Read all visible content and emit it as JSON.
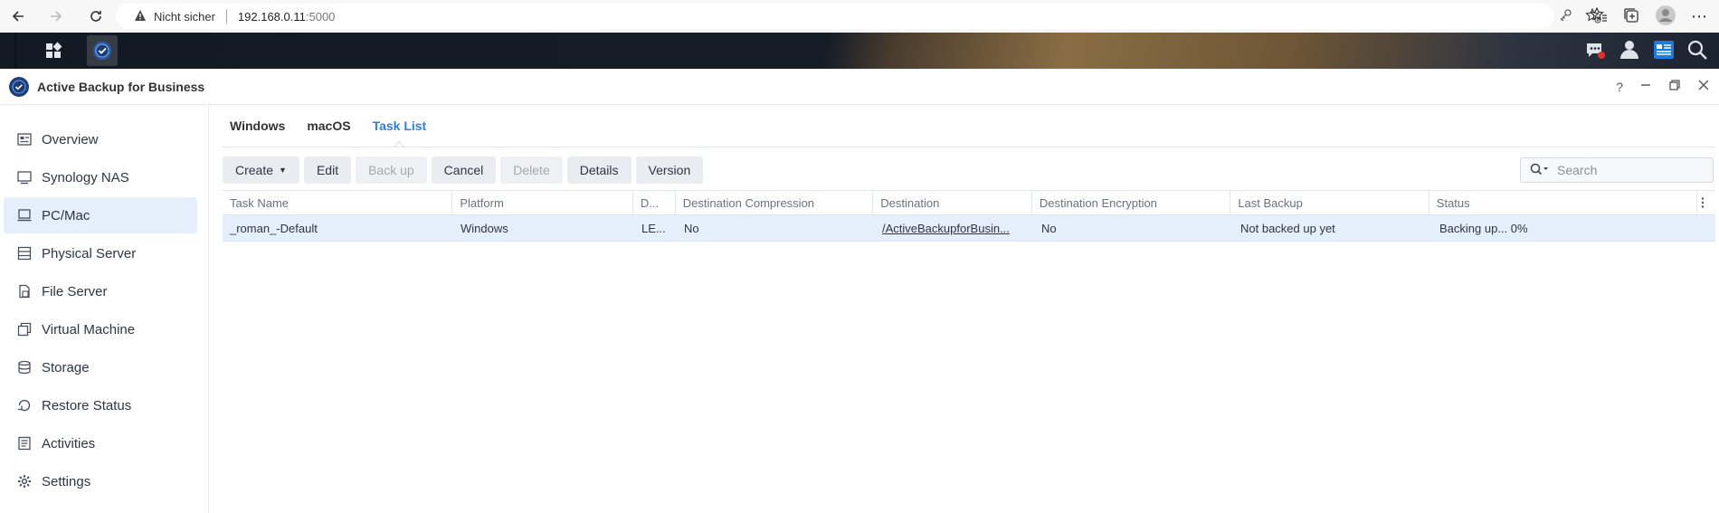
{
  "browser": {
    "security_label": "Nicht sicher",
    "host": "192.168.0.11",
    "port": ":5000"
  },
  "app": {
    "title": "Active Backup for Business",
    "help_label": "?"
  },
  "sidebar": {
    "items": [
      {
        "label": "Overview",
        "icon": "overview-icon"
      },
      {
        "label": "Synology NAS",
        "icon": "nas-icon"
      },
      {
        "label": "PC/Mac",
        "icon": "pc-icon",
        "active": true
      },
      {
        "label": "Physical Server",
        "icon": "server-icon"
      },
      {
        "label": "File Server",
        "icon": "file-server-icon"
      },
      {
        "label": "Virtual Machine",
        "icon": "vm-icon"
      },
      {
        "label": "Storage",
        "icon": "storage-icon"
      },
      {
        "label": "Restore Status",
        "icon": "restore-icon"
      },
      {
        "label": "Activities",
        "icon": "activities-icon"
      },
      {
        "label": "Settings",
        "icon": "settings-icon"
      }
    ]
  },
  "tabs": [
    {
      "label": "Windows"
    },
    {
      "label": "macOS"
    },
    {
      "label": "Task List",
      "active": true
    }
  ],
  "toolbar": {
    "create": "Create",
    "edit": "Edit",
    "backup": "Back up",
    "cancel": "Cancel",
    "delete": "Delete",
    "details": "Details",
    "version": "Version"
  },
  "search": {
    "placeholder": "Search"
  },
  "grid": {
    "columns": [
      "Task Name",
      "Platform",
      "D...",
      "Destination Compression",
      "Destination",
      "Destination Encryption",
      "Last Backup",
      "Status"
    ],
    "rows": [
      [
        "_roman_-Default",
        "Windows",
        "LE...",
        "No",
        "/ActiveBackupforBusin...",
        "No",
        "Not backed up yet",
        "Backing up... 0%"
      ]
    ]
  },
  "colors": {
    "accent": "#2f7fd6",
    "selected_row": "#e5eefb"
  }
}
